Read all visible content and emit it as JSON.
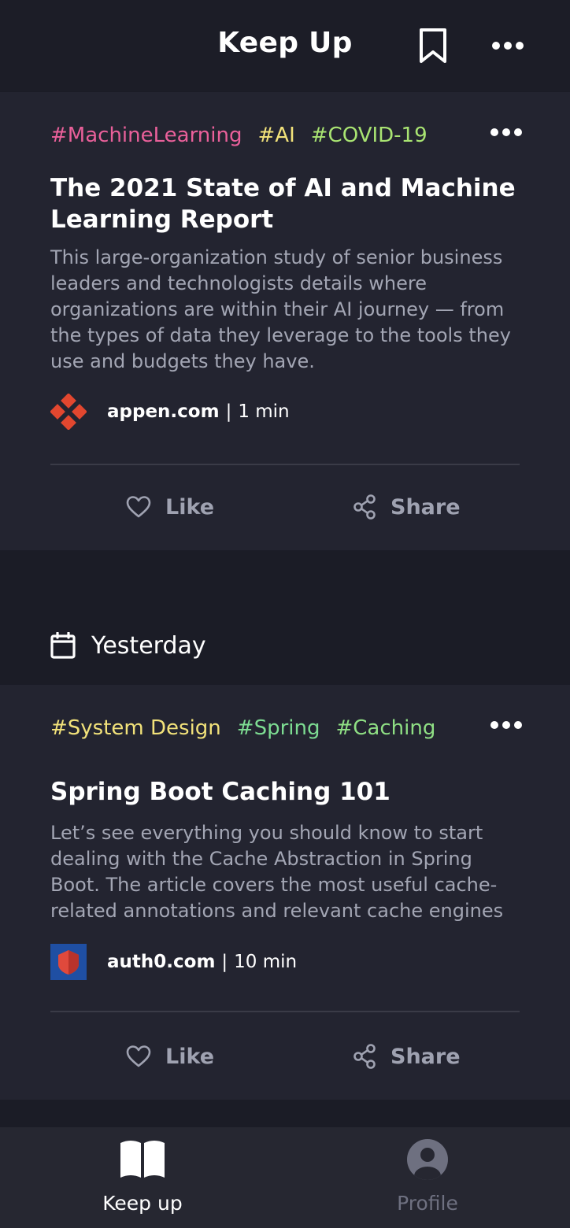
{
  "header": {
    "title": "Keep Up",
    "bookmark_icon": "bookmark-icon",
    "more_icon": "more-horizontal-icon"
  },
  "colors": {
    "pink": "#e9609a",
    "yellow": "#f2e27a",
    "green": "#a9e472",
    "teal": "#7ddc92"
  },
  "cards": [
    {
      "tags": [
        "#MachineLearning",
        "#AI",
        "#COVID-19"
      ],
      "tag_colors": [
        "#e9609a",
        "#f2e27a",
        "#a9e472"
      ],
      "headline": "The 2021 State of AI and Machine Learning Report",
      "description": "This large-organization study of senior business leaders and technologists details where organizations are within their AI journey — from the types of data they leverage to the tools they use and budgets they have.",
      "source": "appen.com",
      "separator": "|",
      "read_time": "1 min",
      "like_label": "Like",
      "share_label": "Share"
    },
    {
      "tags": [
        "#System Design",
        "#Spring",
        "#Caching"
      ],
      "tag_colors": [
        "#f2e27a",
        "#7ddc92",
        "#8fdf84"
      ],
      "headline": "Spring Boot Caching 101",
      "description": "Let’s see everything you should know to start dealing with the Cache Abstraction in Spring Boot. The article covers the most useful cache-related annotations and relevant cache engines",
      "source": "auth0.com",
      "separator": "|",
      "read_time": "10 min",
      "like_label": "Like",
      "share_label": "Share"
    }
  ],
  "date_section": {
    "label": "Yesterday",
    "icon": "calendar-icon"
  },
  "bottom_nav": {
    "items": [
      {
        "label": "Keep up",
        "icon": "open-book-icon",
        "active": true
      },
      {
        "label": "Profile",
        "icon": "user-circle-icon",
        "active": false
      }
    ]
  }
}
